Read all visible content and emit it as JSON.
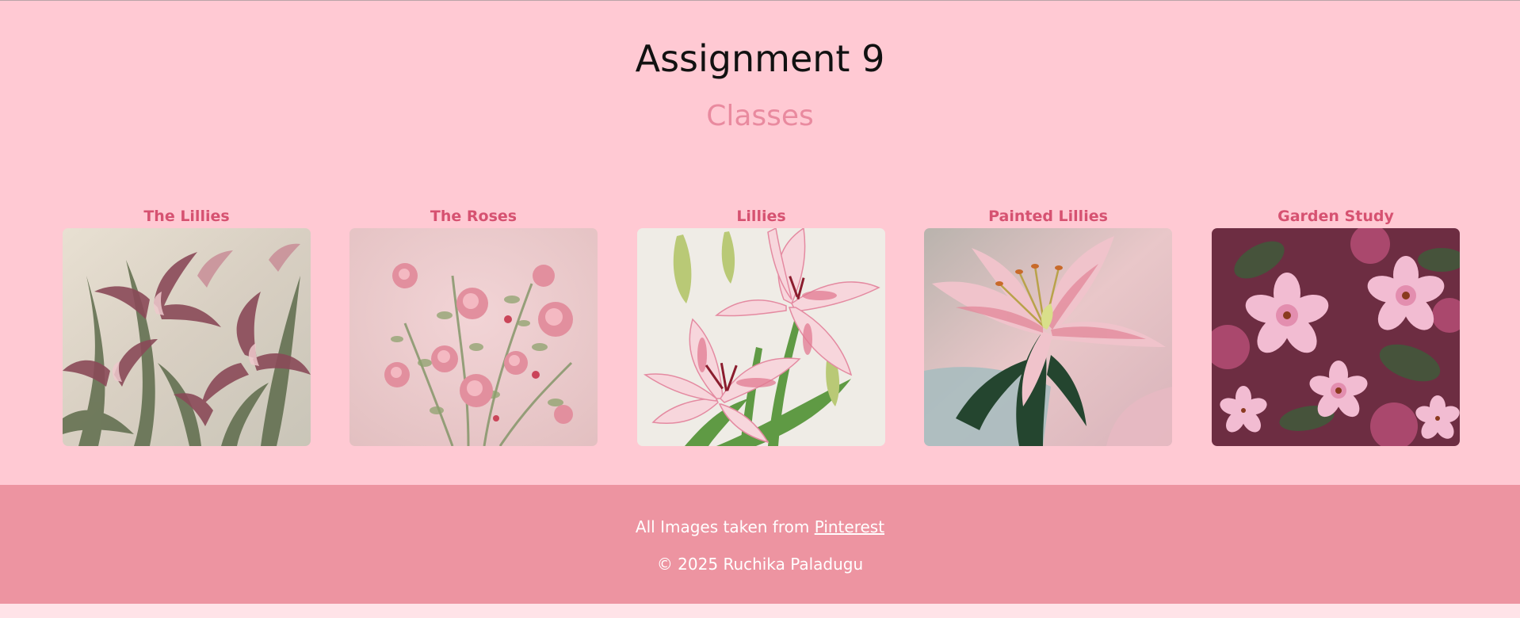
{
  "header": {
    "title": "Assignment 9",
    "subtitle": "Classes"
  },
  "gallery": [
    {
      "caption": "The Lillies",
      "image": "lilies-painting-muted"
    },
    {
      "caption": "The Roses",
      "image": "pink-roses-painting"
    },
    {
      "caption": "Lillies",
      "image": "stargazer-lilies-illustration"
    },
    {
      "caption": "Painted Lillies",
      "image": "painted-lily-closeup"
    },
    {
      "caption": "Garden Study",
      "image": "pink-blossoms-painting"
    }
  ],
  "footer": {
    "credit_text": "All Images taken from ",
    "credit_link": "Pinterest",
    "copyright": "© 2025 Ruchika Paladugu"
  },
  "colors": {
    "page_background": "#ffc9d3",
    "footer_background": "#ed94a1",
    "caption": "#d65271",
    "subtitle": "#e98a9f"
  }
}
